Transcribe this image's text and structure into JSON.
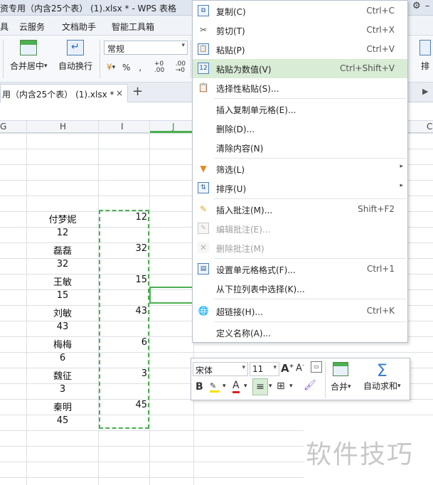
{
  "window": {
    "title": "资专用（内含25个表） (1).xlsx * - WPS 表格"
  },
  "menubar": {
    "items": [
      "具",
      "云服务",
      "文档助手",
      "智能工具箱"
    ]
  },
  "ribbon": {
    "merge_center": "合并居中",
    "auto_wrap": "自动换行",
    "number_format": "常规",
    "percent": "%",
    "thousands": "‚",
    "inc_decimal": "+0 .00",
    "dec_decimal": ".00 →0",
    "right_partial": "排"
  },
  "tabs": {
    "doc_tab": "用（内含25个表） (1).xlsx *",
    "close": "×",
    "add": "+"
  },
  "sheet": {
    "columns": [
      "G",
      "H",
      "I",
      "J",
      "C"
    ],
    "colH": [
      "付梦妮",
      "12",
      "磊磊",
      "32",
      "王敏",
      "15",
      "刘敏",
      "43",
      "梅梅",
      "6",
      "魏征",
      "3",
      "秦明",
      "45"
    ],
    "colI": [
      "12",
      "32",
      "15",
      "43",
      "6",
      "3",
      "45"
    ]
  },
  "context_menu": {
    "items": [
      {
        "label": "复制(C)",
        "shortcut": "Ctrl+C",
        "icon": "copy-icon"
      },
      {
        "label": "剪切(T)",
        "shortcut": "Ctrl+X",
        "icon": "scissors-icon"
      },
      {
        "label": "粘贴(P)",
        "shortcut": "Ctrl+V",
        "icon": "paste-icon"
      },
      {
        "label": "粘贴为数值(V)",
        "shortcut": "Ctrl+Shift+V",
        "icon": "paste-values-icon",
        "highlighted": true
      },
      {
        "label": "选择性粘贴(S)...",
        "shortcut": "",
        "icon": "paste-special-icon"
      },
      {
        "label": "插入复制单元格(E)...",
        "shortcut": ""
      },
      {
        "label": "删除(D)...",
        "shortcut": ""
      },
      {
        "label": "清除内容(N)",
        "shortcut": ""
      },
      {
        "label": "筛选(L)",
        "shortcut": "",
        "icon": "filter-icon",
        "submenu": true
      },
      {
        "label": "排序(U)",
        "shortcut": "",
        "icon": "sort-icon",
        "submenu": true
      },
      {
        "label": "插入批注(M)...",
        "shortcut": "Shift+F2",
        "icon": "insert-comment-icon"
      },
      {
        "label": "编辑批注(E)...",
        "shortcut": "",
        "icon": "edit-comment-icon",
        "disabled": true
      },
      {
        "label": "删除批注(M)",
        "shortcut": "",
        "icon": "delete-comment-icon",
        "disabled": true
      },
      {
        "label": "设置单元格格式(F)...",
        "shortcut": "Ctrl+1",
        "icon": "format-cells-icon"
      },
      {
        "label": "从下拉列表中选择(K)...",
        "shortcut": ""
      },
      {
        "label": "超链接(H)...",
        "shortcut": "Ctrl+K",
        "icon": "hyperlink-icon"
      },
      {
        "label": "定义名称(A)...",
        "shortcut": ""
      }
    ]
  },
  "mini_toolbar": {
    "font": "宋体",
    "size": "11",
    "merge": "合并",
    "autosum": "自动求和"
  },
  "watermark": "软件技巧",
  "colors": {
    "accent_green": "#4caf50",
    "menu_highlight": "#d9ecd6"
  }
}
